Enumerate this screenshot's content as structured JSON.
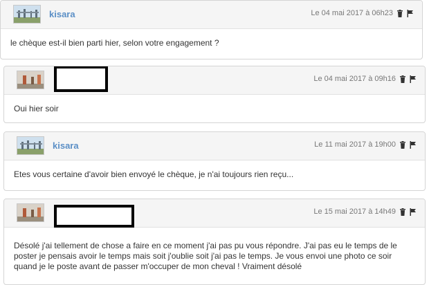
{
  "messages": [
    {
      "author": "kisara",
      "date": "Le 04 mai 2017 à 06h23",
      "text": "le chèque est-il bien parti hier, selon votre engagement ?"
    },
    {
      "author": "",
      "date": "Le 04 mai 2017 à 09h16",
      "text": "Oui hier soir"
    },
    {
      "author": "kisara",
      "date": "Le 11 mai 2017 à 19h00",
      "text": "Etes vous certaine d'avoir bien envoyé le chèque, je n'ai toujours rien reçu..."
    },
    {
      "author": "",
      "date": "Le 15 mai 2017 à 14h49",
      "text": "Désolé j'ai tellement de chose a faire en ce moment j'ai pas pu vous répondre. J'ai pas eu le temps de le poster je pensais avoir le temps mais soit j'oublie soit j'ai pas le temps. Je vous envoi une photo ce soir quand je le poste avant de passer m'occuper de mon cheval ! Vraiment désolé"
    }
  ],
  "icons": {
    "delete": "trash-icon",
    "report": "flag-icon"
  }
}
